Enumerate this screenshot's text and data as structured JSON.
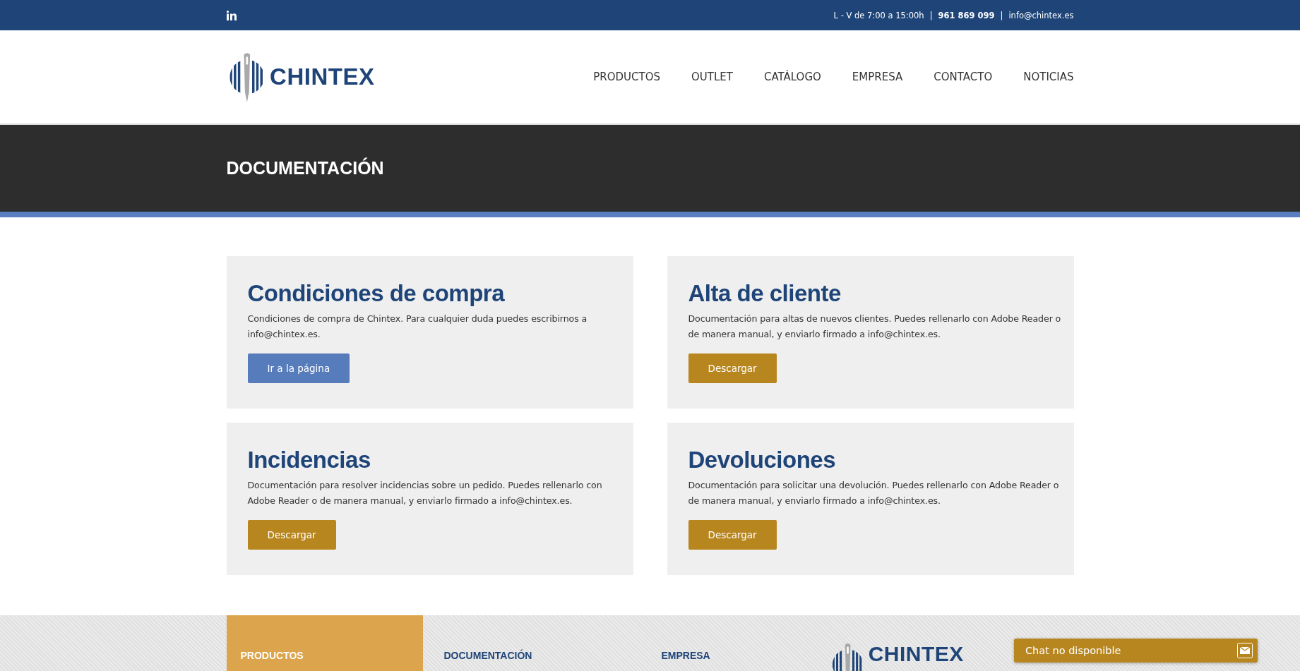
{
  "top_bar": {
    "hours": "L - V de 7:00 a 15:00h",
    "phone": "961 869 099",
    "email": "info@chintex.es",
    "separator": "|"
  },
  "header": {
    "logo": "CHINTEX",
    "nav": [
      {
        "label": "PRODUCTOS"
      },
      {
        "label": "OUTLET"
      },
      {
        "label": "CATÁLOGO"
      },
      {
        "label": "EMPRESA"
      },
      {
        "label": "CONTACTO"
      },
      {
        "label": "NOTICIAS"
      }
    ]
  },
  "banner": {
    "title": "DOCUMENTACIÓN"
  },
  "cards": [
    {
      "title": "Condiciones de compra",
      "text": "Condiciones de compra de Chintex. Para cualquier duda puedes escribirnos a info@chintex.es.",
      "button": "Ir a la página",
      "kind": "link"
    },
    {
      "title": "Alta de cliente",
      "text": "Documentación para altas de nuevos clientes. Puedes rellenarlo con Adobe Reader o de manera manual, y enviarlo firmado a info@chintex.es.",
      "button": "Descargar",
      "kind": "download"
    },
    {
      "title": "Incidencias",
      "text": "Documentación para resolver incidencias sobre un pedido. Puedes rellenarlo con Adobe Reader o de manera manual, y enviarlo firmado a info@chintex.es.",
      "button": "Descargar",
      "kind": "download"
    },
    {
      "title": "Devoluciones",
      "text": "Documentación para solicitar una devolución. Puedes rellenarlo con Adobe Reader o de manera manual, y enviarlo firmado a info@chintex.es.",
      "button": "Descargar",
      "kind": "download"
    }
  ],
  "footer": {
    "columns": [
      {
        "heading": "PRODUCTOS",
        "highlighted": true
      },
      {
        "heading": "DOCUMENTACIÓN",
        "highlighted": false
      },
      {
        "heading": "EMPRESA",
        "highlighted": false
      }
    ],
    "logo": "CHINTEX"
  },
  "chat": {
    "label": "Chat no disponible"
  }
}
